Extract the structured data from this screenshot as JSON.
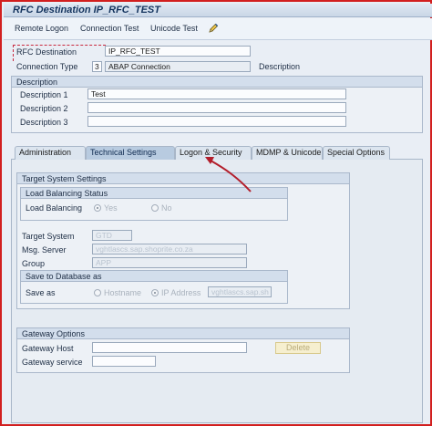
{
  "window": {
    "title": "RFC Destination IP_RFC_TEST"
  },
  "toolbar": {
    "remote_logon": "Remote Logon",
    "connection_test": "Connection Test",
    "unicode_test": "Unicode Test"
  },
  "header": {
    "rfc_destination_label": "RFC Destination",
    "rfc_destination_value": "IP_RFC_TEST",
    "connection_type_label": "Connection Type",
    "connection_type_code": "3",
    "connection_type_value": "ABAP Connection",
    "description_label": "Description"
  },
  "description_group": {
    "title": "Description",
    "rows": [
      {
        "label": "Description 1",
        "value": "Test"
      },
      {
        "label": "Description 2",
        "value": ""
      },
      {
        "label": "Description 3",
        "value": ""
      }
    ]
  },
  "tabs": [
    {
      "label": "Administration"
    },
    {
      "label": "Technical Settings"
    },
    {
      "label": "Logon & Security"
    },
    {
      "label": "MDMP & Unicode"
    },
    {
      "label": "Special Options"
    }
  ],
  "target_system_settings": {
    "title": "Target System Settings",
    "load_balancing": {
      "title": "Load Balancing Status",
      "label": "Load Balancing",
      "yes": "Yes",
      "no": "No"
    },
    "target_system_label": "Target System",
    "target_system_value": "GTD",
    "msg_server_label": "Msg. Server",
    "msg_server_value": "vghtlascs.sap.shoprite.co.za",
    "group_label": "Group",
    "group_value": "APP",
    "save_to_db": {
      "title": "Save to Database as",
      "label": "Save as",
      "hostname": "Hostname",
      "ip_address": "IP Address",
      "value": "vghtlascs.sap.sh"
    }
  },
  "gateway_options": {
    "title": "Gateway Options",
    "host_label": "Gateway Host",
    "service_label": "Gateway service",
    "delete_label": "Delete"
  },
  "colors": {
    "frame_border": "#d21f1f",
    "arrow": "#b31e2b",
    "title_text": "#14345e"
  }
}
